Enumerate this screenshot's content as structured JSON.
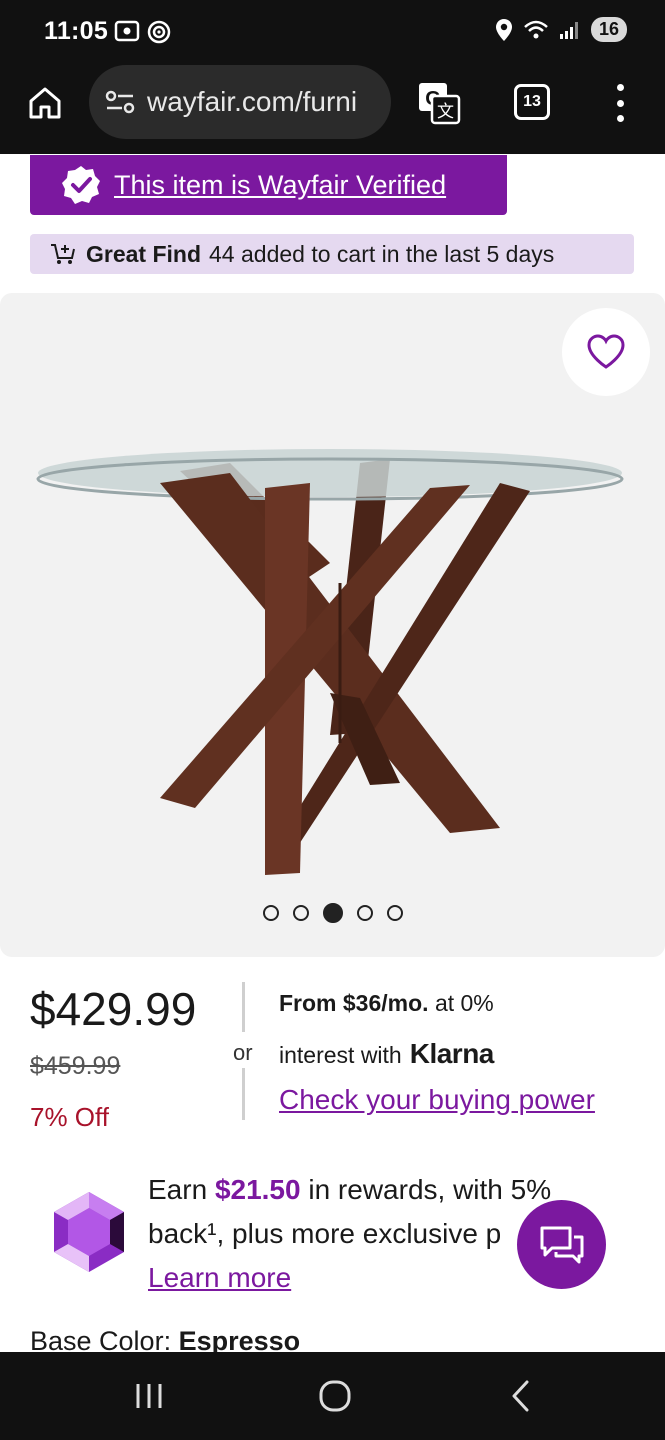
{
  "status_bar": {
    "time": "11:05",
    "battery": "16"
  },
  "browser": {
    "url": "wayfair.com/furni",
    "tab_count": "13"
  },
  "verified_banner": {
    "text": "This item is Wayfair Verified"
  },
  "great_find": {
    "label": "Great Find",
    "text": "44 added to cart in the last 5 days"
  },
  "gallery": {
    "image_count": 5,
    "active_index": 2
  },
  "price": {
    "current": "$429.99",
    "original": "$459.99",
    "discount": "7% Off",
    "or_label": "or"
  },
  "financing": {
    "from_label": "From",
    "monthly": "$36/mo.",
    "rate_text": "at 0%",
    "interest_text": "interest with",
    "provider": "Klarna",
    "link": "Check your buying power"
  },
  "rewards": {
    "earn_prefix": "Earn",
    "amount": "$21.50",
    "earn_suffix": "in rewards, with 5%",
    "line2": "back¹, plus more exclusive p",
    "link": "Learn more"
  },
  "base_color": {
    "label": "Base Color:",
    "value": "Espresso"
  },
  "colors": {
    "brand": "#7b189f",
    "discount": "#a8122a",
    "great_find_bg": "#e5d9f0"
  }
}
